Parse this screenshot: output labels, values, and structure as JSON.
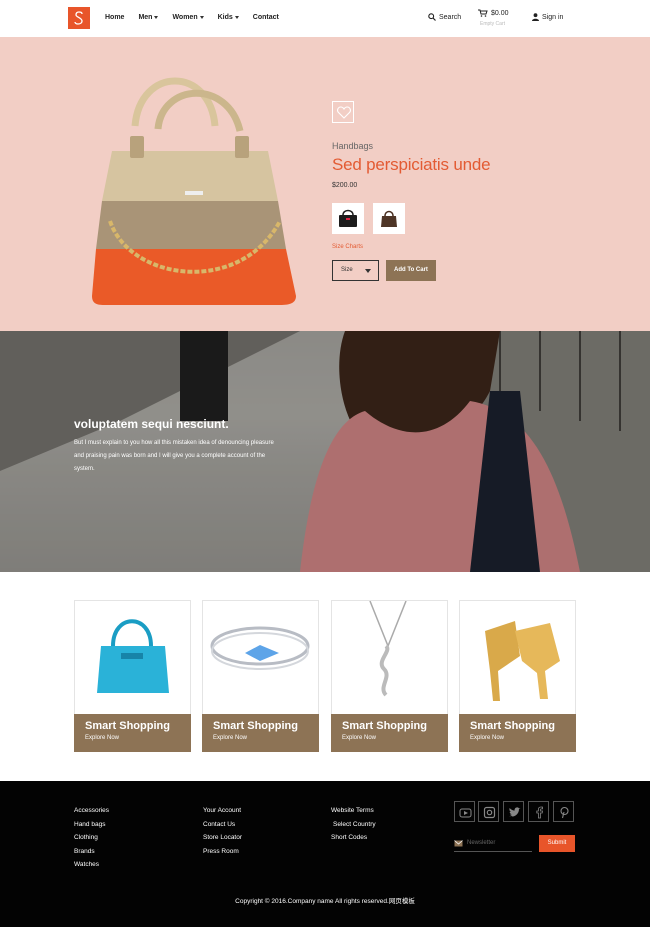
{
  "header": {
    "logo_icon": "s-logo-icon",
    "nav": [
      {
        "label": "Home",
        "dropdown": false
      },
      {
        "label": "Men",
        "dropdown": true
      },
      {
        "label": "Women",
        "dropdown": true
      },
      {
        "label": "Kids",
        "dropdown": true
      },
      {
        "label": "Contact",
        "dropdown": false
      }
    ],
    "search_label": "Search",
    "cart_amount": "$0.00",
    "cart_status": "Empty Cart",
    "signin_label": "Sign in"
  },
  "hero": {
    "category": "Handbags",
    "title": "Sed perspiciatis unde",
    "price": "$200.00",
    "size_chart_label": "Size Charts",
    "size_select": "Size",
    "add_to_cart": "Add To Cart"
  },
  "banner": {
    "title": "voluptatem sequi nesciunt.",
    "text": "But I must explain to you how all this mistaken idea of denouncing pleasure and praising pain was born and I will give you a complete account of the system."
  },
  "products": [
    {
      "title": "Smart Shopping",
      "link": "Explore Now",
      "image": "blue-handbag"
    },
    {
      "title": "Smart Shopping",
      "link": "Explore Now",
      "image": "bracelet"
    },
    {
      "title": "Smart Shopping",
      "link": "Explore Now",
      "image": "necklace"
    },
    {
      "title": "Smart Shopping",
      "link": "Explore Now",
      "image": "heels"
    }
  ],
  "footer": {
    "col1": [
      "Accessories",
      "Hand bags",
      "Clothing",
      "Brands",
      "Watches"
    ],
    "col2": [
      "Your Account",
      "Contact Us",
      "Store Locator",
      "Press Room"
    ],
    "col3": [
      "Website Terms",
      "Select Country",
      "Short Codes"
    ],
    "social": [
      "youtube-icon",
      "instagram-icon",
      "twitter-icon",
      "facebook-icon",
      "pinterest-icon"
    ],
    "newsletter_placeholder": "Newsletter",
    "submit_label": "Submit",
    "copyright": "Copyright © 2016.Company name All rights reserved.网页模板"
  },
  "colors": {
    "accent": "#e8552a",
    "hero_bg": "#f2cec5",
    "brown": "#8d7355",
    "footer_bg": "#030303"
  }
}
